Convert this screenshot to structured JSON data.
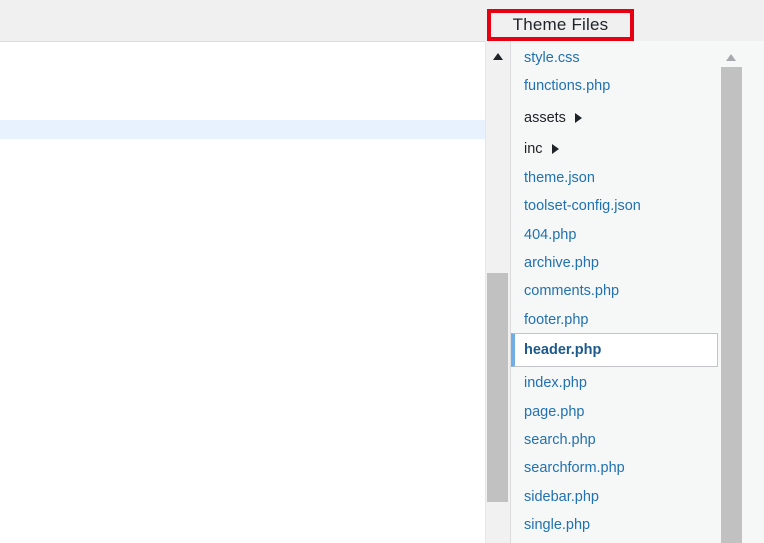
{
  "theme_files": {
    "heading": "Theme Files",
    "highlight_color": "#e60012",
    "items": [
      {
        "label": "style.css",
        "type": "file"
      },
      {
        "label": "functions.php",
        "type": "file"
      },
      {
        "label": "assets",
        "type": "folder"
      },
      {
        "label": "inc",
        "type": "folder"
      },
      {
        "label": "theme.json",
        "type": "file"
      },
      {
        "label": "toolset-config.json",
        "type": "file"
      },
      {
        "label": "404.php",
        "type": "file"
      },
      {
        "label": "archive.php",
        "type": "file"
      },
      {
        "label": "comments.php",
        "type": "file"
      },
      {
        "label": "footer.php",
        "type": "file"
      },
      {
        "label": "header.php",
        "type": "file",
        "active": true
      },
      {
        "label": "index.php",
        "type": "file"
      },
      {
        "label": "page.php",
        "type": "file"
      },
      {
        "label": "search.php",
        "type": "file"
      },
      {
        "label": "searchform.php",
        "type": "file"
      },
      {
        "label": "sidebar.php",
        "type": "file"
      },
      {
        "label": "single.php",
        "type": "file"
      }
    ]
  },
  "icons": {
    "editor_scroll_up": "caret-up-icon",
    "file_scroll_up": "caret-up-icon",
    "folder_expand": "caret-right-icon"
  },
  "colors": {
    "link": "#2271b1",
    "active_accent": "#72aee6",
    "editor_active_line": "#e8f2fe"
  }
}
